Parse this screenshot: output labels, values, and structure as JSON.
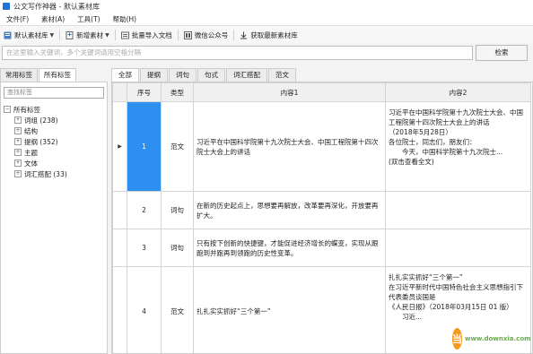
{
  "window": {
    "title": "公文写作神器 - 默认素材库"
  },
  "menu": [
    "文件(F)",
    "素材(A)",
    "工具(T)",
    "帮助(H)"
  ],
  "toolbar": {
    "library": "默认素材库",
    "new_material": "新增素材",
    "batch_import": "批量导入文档",
    "wechat": "微信公众号",
    "fetch_latest": "获取最新素材库"
  },
  "search": {
    "placeholder": "在这里输入关键词，多个关键词请用空格分隔",
    "button": "检索"
  },
  "left_tabs": [
    "常用标签",
    "所有标签"
  ],
  "filter_placeholder": "查找标签",
  "tree": {
    "root": "所有标签",
    "children": [
      "词组 (238)",
      "结构",
      "提纲 (352)",
      "主题",
      "文体",
      "词汇搭配 (33)"
    ]
  },
  "content_tabs": [
    "全部",
    "提纲",
    "词句",
    "句式",
    "词汇搭配",
    "范文"
  ],
  "table": {
    "headers": [
      "序号",
      "类型",
      "内容1",
      "内容2"
    ],
    "rows": [
      {
        "no": "1",
        "type": "范文",
        "content1": "习近平在中国科学院第十九次院士大会、中国工程院第十四次院士大会上的讲话",
        "content2": "习近平在中国科学院第十九次院士大会、中国工程院第十四次院士大会上的讲话\n（2018年5月28日）\n各位院士，同志们，朋友们：\n　　今天，中国科学院第十九次院士...\n(双击查看全文)"
      },
      {
        "no": "2",
        "type": "词句",
        "content1": "在新的历史起点上，思想要再解放，改革要再深化，开放要再扩大。",
        "content2": ""
      },
      {
        "no": "3",
        "type": "词句",
        "content1": "只有按下创新的快捷键，才能促进经济增长的蝶变，实现从跟跑到并跑再到领跑的历史性变革。",
        "content2": ""
      },
      {
        "no": "4",
        "type": "范文",
        "content1": "扎扎实实抓好“三个第一”",
        "content2": "扎扎实实抓好“三个第一”\n在习近平新时代中国特色社会主义思想指引下 代表委员谈国是\n《人民日报》（2018年03月15日 01 版）\n　　习近..."
      }
    ]
  },
  "watermark": {
    "logo": "当",
    "text": "www.downxia.com"
  }
}
